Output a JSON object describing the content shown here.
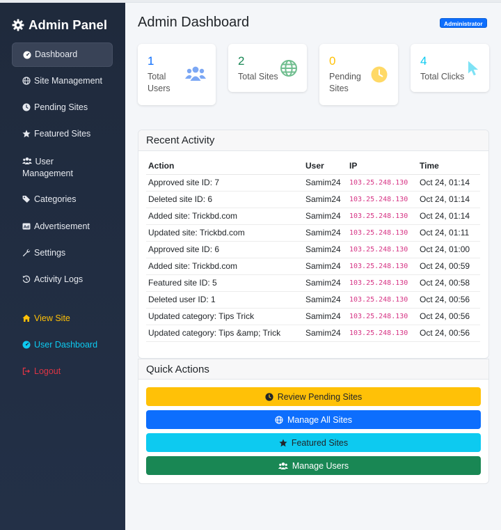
{
  "brand": {
    "title": "Admin Panel"
  },
  "sidebar": {
    "items": [
      {
        "label": "Dashboard",
        "icon": "gauge-icon",
        "active": true
      },
      {
        "label": "Site Management",
        "icon": "globe-icon"
      },
      {
        "label": "Pending Sites",
        "icon": "clock-icon"
      },
      {
        "label": "Featured Sites",
        "icon": "star-icon"
      },
      {
        "label": "User Management",
        "icon": "users-icon"
      },
      {
        "label": "Categories",
        "icon": "tags-icon"
      },
      {
        "label": "Advertisement",
        "icon": "ad-icon"
      },
      {
        "label": "Settings",
        "icon": "wrench-icon"
      },
      {
        "label": "Activity Logs",
        "icon": "history-icon"
      }
    ],
    "links": [
      {
        "label": "View Site",
        "icon": "home-icon",
        "color": "#ffc107"
      },
      {
        "label": "User Dashboard",
        "icon": "gauge-icon",
        "color": "#0dcaf0"
      },
      {
        "label": "Logout",
        "icon": "sign-out-icon",
        "color": "#dc3545"
      }
    ]
  },
  "header": {
    "title": "Admin Dashboard",
    "badge": "Administrator"
  },
  "stats": [
    {
      "value": "1",
      "label": "Total Users",
      "color": "#0d6efd",
      "icon": "users-icon"
    },
    {
      "value": "2",
      "label": "Total Sites",
      "color": "#198754",
      "icon": "globe-icon"
    },
    {
      "value": "0",
      "label": "Pending Sites",
      "color": "#ffc107",
      "icon": "clock-icon"
    },
    {
      "value": "4",
      "label": "Total Clicks",
      "color": "#0dcaf0",
      "icon": "cursor-icon"
    }
  ],
  "activity": {
    "title": "Recent Activity",
    "columns": [
      "Action",
      "User",
      "IP",
      "Time"
    ],
    "rows": [
      {
        "action": "Approved site ID: 7",
        "user": "Samim24",
        "ip": "103.25.248.130",
        "time": "Oct 24, 01:14"
      },
      {
        "action": "Deleted site ID: 6",
        "user": "Samim24",
        "ip": "103.25.248.130",
        "time": "Oct 24, 01:14"
      },
      {
        "action": "Added site: Trickbd.com",
        "user": "Samim24",
        "ip": "103.25.248.130",
        "time": "Oct 24, 01:14"
      },
      {
        "action": "Updated site: Trickbd.com",
        "user": "Samim24",
        "ip": "103.25.248.130",
        "time": "Oct 24, 01:11"
      },
      {
        "action": "Approved site ID: 6",
        "user": "Samim24",
        "ip": "103.25.248.130",
        "time": "Oct 24, 01:00"
      },
      {
        "action": "Added site: Trickbd.com",
        "user": "Samim24",
        "ip": "103.25.248.130",
        "time": "Oct 24, 00:59"
      },
      {
        "action": "Featured site ID: 5",
        "user": "Samim24",
        "ip": "103.25.248.130",
        "time": "Oct 24, 00:58"
      },
      {
        "action": "Deleted user ID: 1",
        "user": "Samim24",
        "ip": "103.25.248.130",
        "time": "Oct 24, 00:56"
      },
      {
        "action": "Updated category: Tips Trick",
        "user": "Samim24",
        "ip": "103.25.248.130",
        "time": "Oct 24, 00:56"
      },
      {
        "action": "Updated category: Tips &amp; Trick",
        "user": "Samim24",
        "ip": "103.25.248.130",
        "time": "Oct 24, 00:56"
      }
    ]
  },
  "quick_actions": {
    "title": "Quick Actions",
    "buttons": [
      {
        "label": "Review Pending Sites",
        "icon": "clock-icon",
        "color": "#ffc107"
      },
      {
        "label": "Manage All Sites",
        "icon": "globe-icon",
        "color": "#0d6efd"
      },
      {
        "label": "Featured Sites",
        "icon": "star-icon",
        "color": "#0dcaf0"
      },
      {
        "label": "Manage Users",
        "icon": "users-icon",
        "color": "#198754"
      }
    ]
  }
}
